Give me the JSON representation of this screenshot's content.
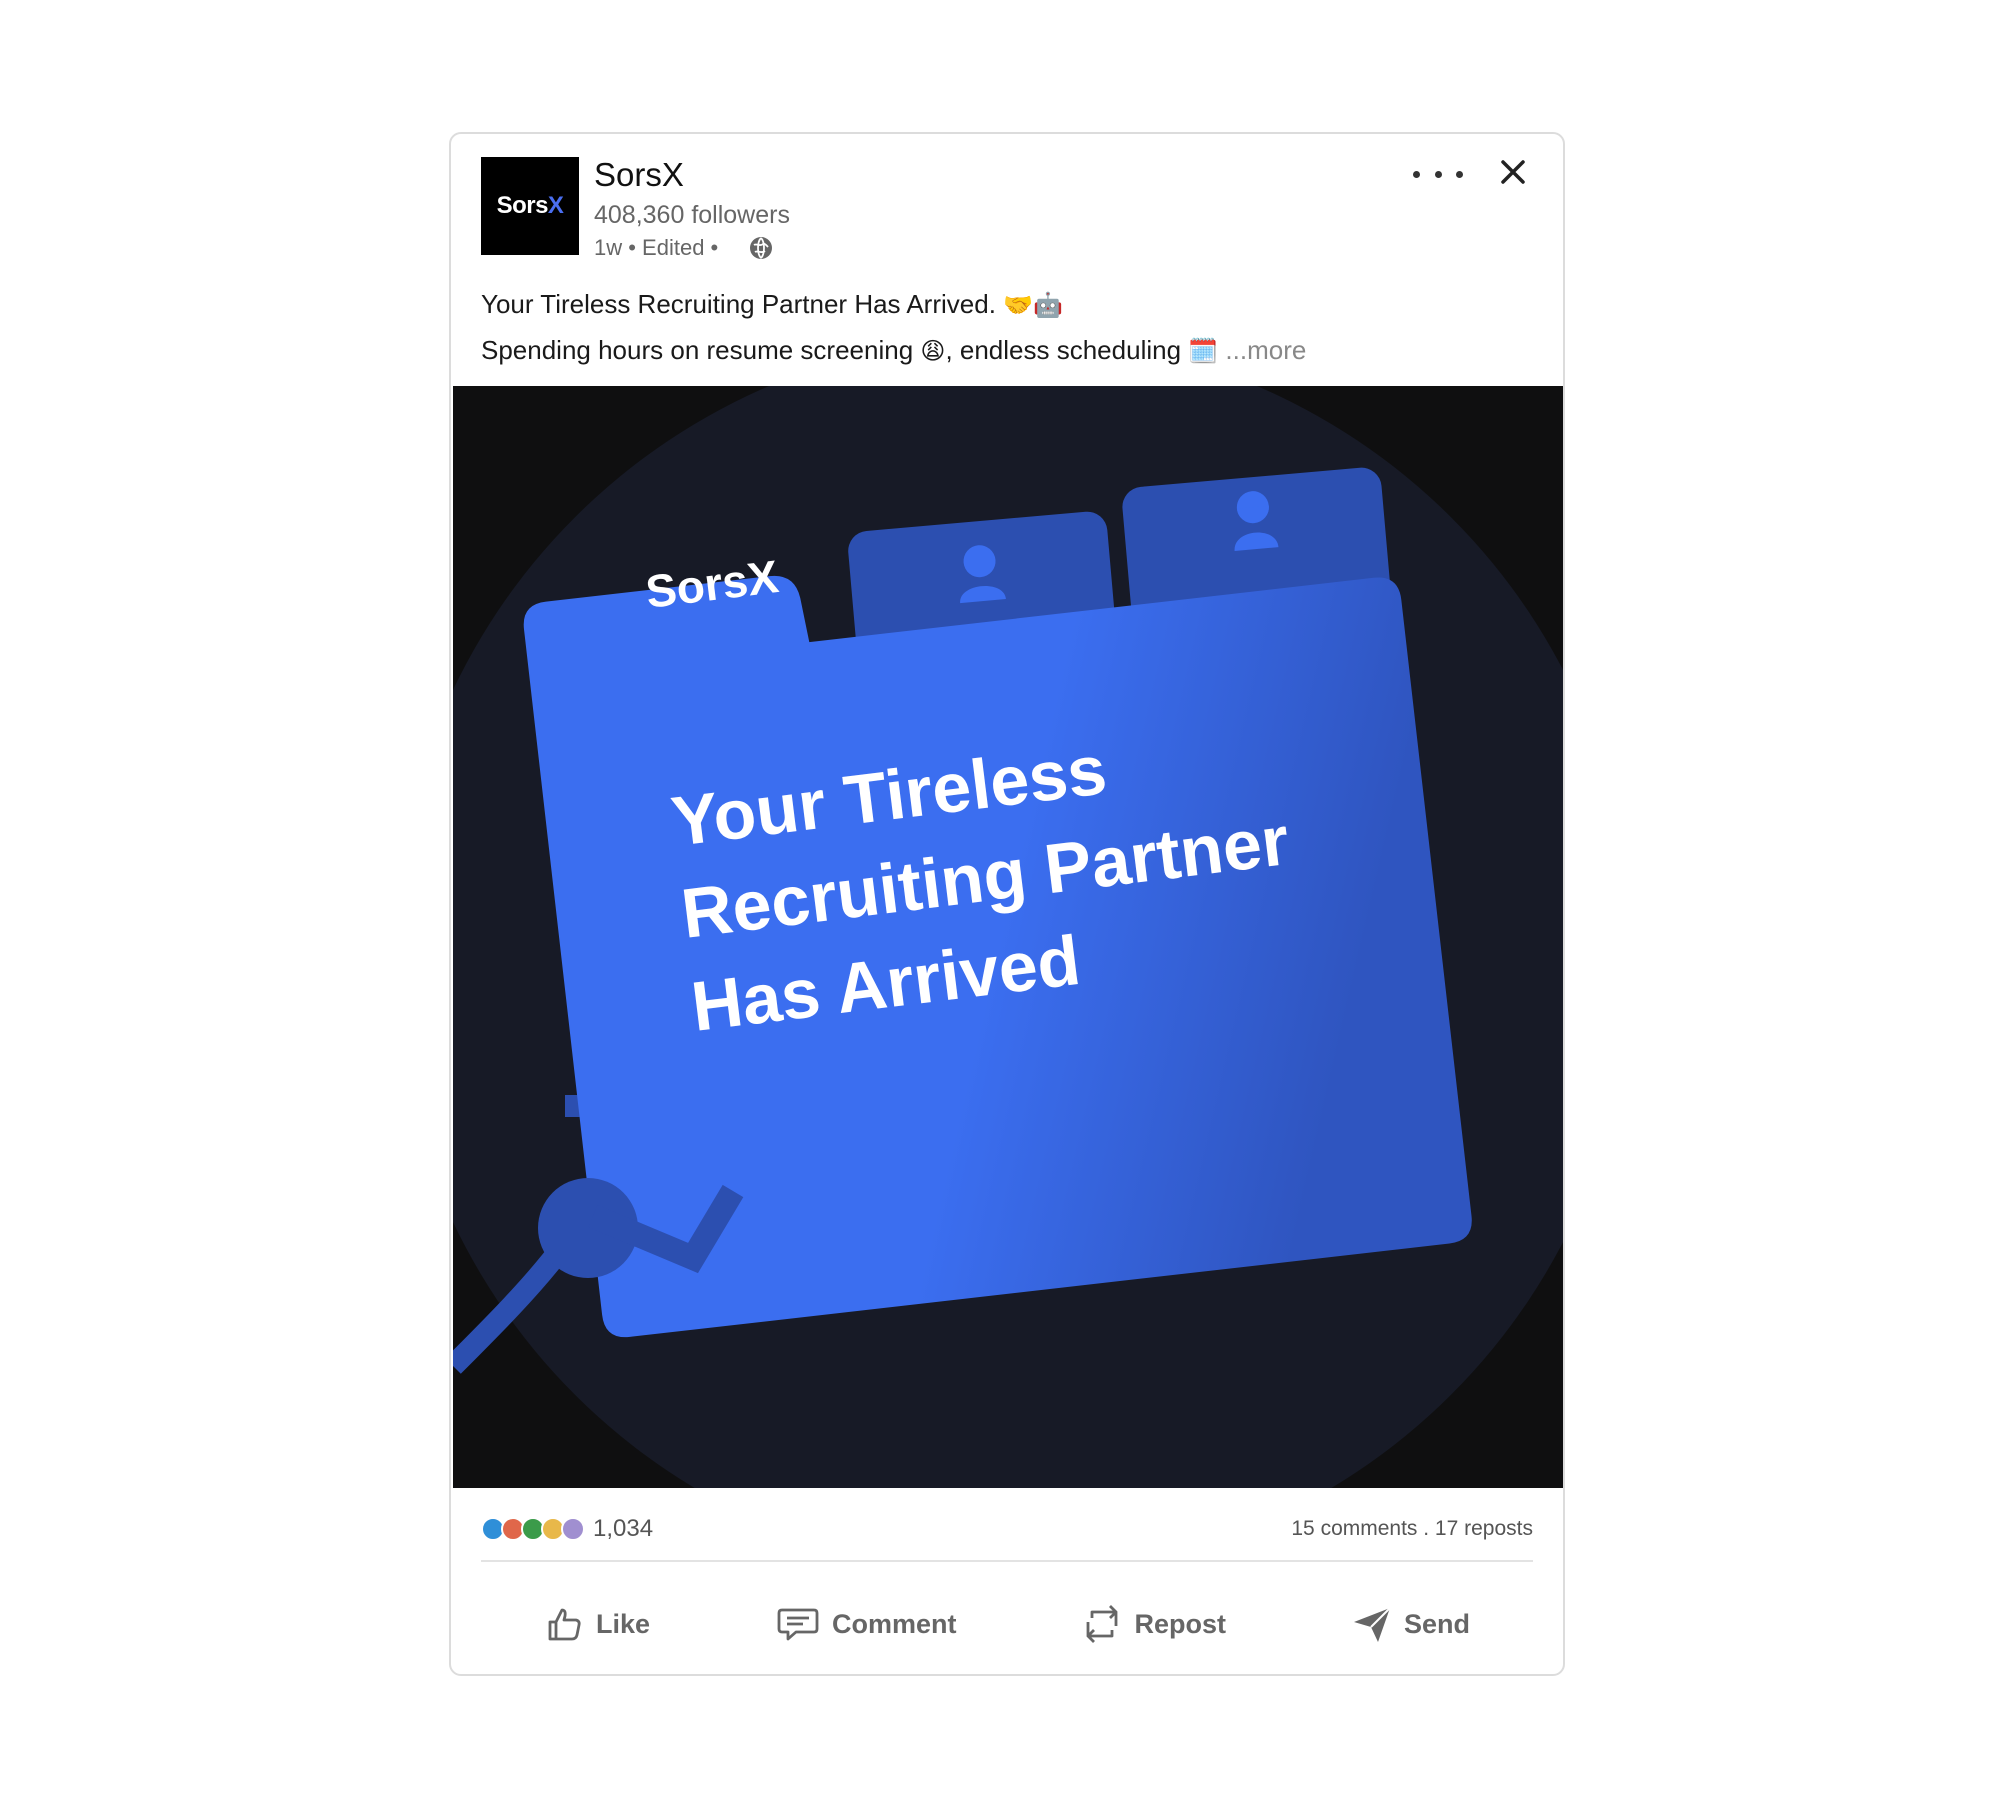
{
  "post": {
    "author": {
      "logo_text": "Sors",
      "logo_text_accent": "X",
      "name": "SorsX",
      "followers": "408,360 followers",
      "meta": "1w • Edited •"
    },
    "text": {
      "line1": "Your Tireless Recruiting Partner Has Arrived.",
      "line1_emoji": "🤝🤖",
      "line2": "Spending hours on resume screening",
      "line2_emoji": "😩",
      "line2_cont": ", endless scheduling",
      "line2_emoji2": "🗓️",
      "more": "...more"
    },
    "media": {
      "brand": "SorsX",
      "headline_line1": "Your Tireless",
      "headline_line2": "Recruiting Partner",
      "headline_line3": "Has Arrived"
    },
    "stats": {
      "reaction_count": "1,034",
      "engagement": "15 comments . 17 reposts",
      "reaction_icons": [
        "like-icon",
        "love-icon",
        "support-icon",
        "insightful-icon",
        "funny-icon"
      ]
    },
    "actions": {
      "like": "Like",
      "comment": "Comment",
      "repost": "Repost",
      "send": "Send"
    }
  },
  "colors": {
    "folder_blue": "#3b6ef0",
    "folder_tab_dark": "#2c4fb0",
    "background_circle": "#171a26",
    "accent_x": "#4a6ef0"
  }
}
